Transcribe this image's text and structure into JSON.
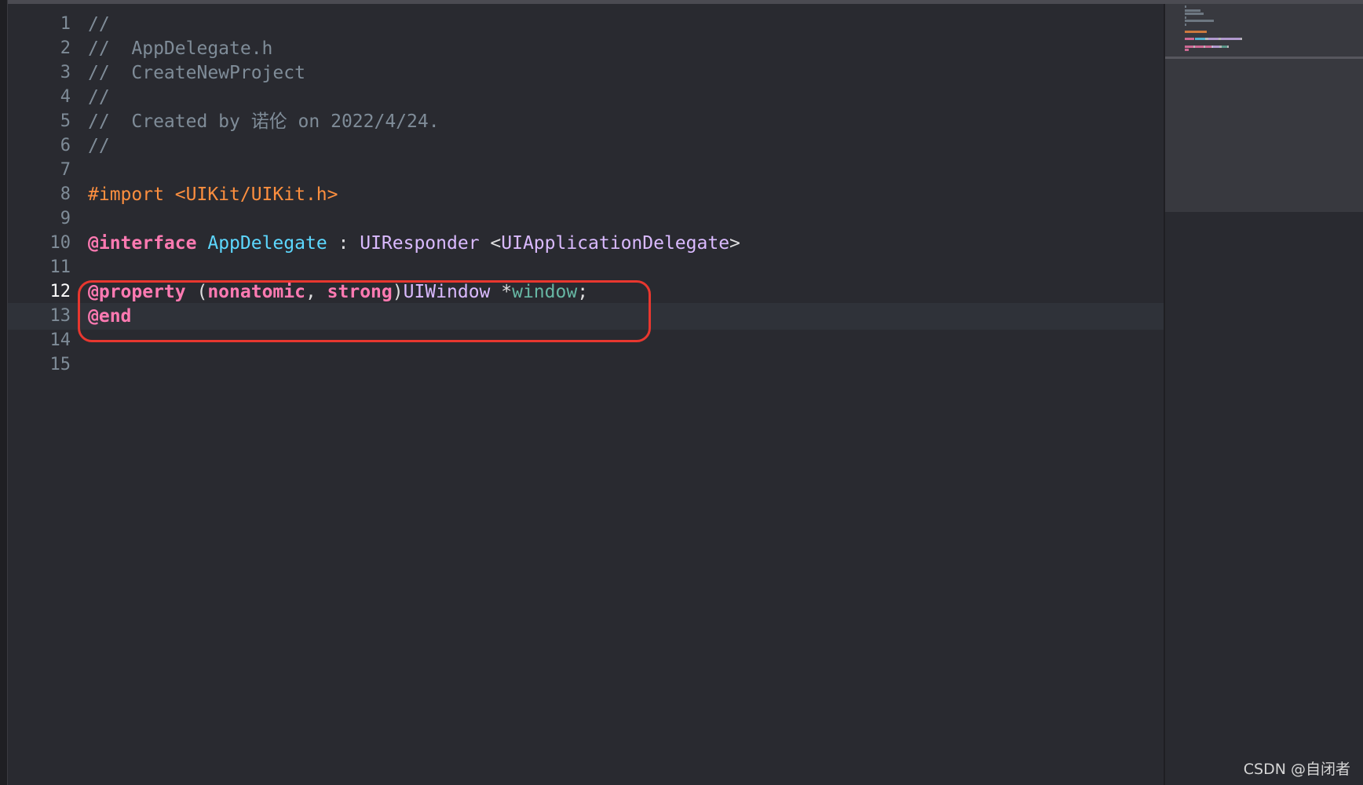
{
  "editor": {
    "current_line": "12",
    "line_numbers": [
      "1",
      "2",
      "3",
      "4",
      "5",
      "6",
      "7",
      "8",
      "9",
      "10",
      "11",
      "12",
      "13",
      "14",
      "15"
    ],
    "lines": [
      {
        "tokens": [
          {
            "kind": "comment",
            "text": "//"
          }
        ]
      },
      {
        "tokens": [
          {
            "kind": "comment",
            "text": "//  AppDelegate.h"
          }
        ]
      },
      {
        "tokens": [
          {
            "kind": "comment",
            "text": "//  CreateNewProject"
          }
        ]
      },
      {
        "tokens": [
          {
            "kind": "comment",
            "text": "//"
          }
        ]
      },
      {
        "tokens": [
          {
            "kind": "comment",
            "text": "//  Created by 诺伦 on 2022/4/24."
          }
        ]
      },
      {
        "tokens": [
          {
            "kind": "comment",
            "text": "//"
          }
        ]
      },
      {
        "tokens": []
      },
      {
        "tokens": [
          {
            "kind": "preproc",
            "text": "#import <UIKit/UIKit.h>"
          }
        ]
      },
      {
        "tokens": []
      },
      {
        "tokens": [
          {
            "kind": "keyword",
            "text": "@interface"
          },
          {
            "kind": "plain",
            "text": " "
          },
          {
            "kind": "class-decl",
            "text": "AppDelegate"
          },
          {
            "kind": "plain",
            "text": " : "
          },
          {
            "kind": "type-name",
            "text": "UIResponder"
          },
          {
            "kind": "plain",
            "text": " <"
          },
          {
            "kind": "type-name",
            "text": "UIApplicationDelegate"
          },
          {
            "kind": "plain",
            "text": ">"
          }
        ]
      },
      {
        "tokens": []
      },
      {
        "tokens": [
          {
            "kind": "keyword",
            "text": "@property"
          },
          {
            "kind": "plain",
            "text": " ("
          },
          {
            "kind": "keyword",
            "text": "nonatomic"
          },
          {
            "kind": "plain",
            "text": ", "
          },
          {
            "kind": "keyword",
            "text": "strong"
          },
          {
            "kind": "plain",
            "text": ")"
          },
          {
            "kind": "type-name",
            "text": "UIWindow"
          },
          {
            "kind": "plain",
            "text": " *"
          },
          {
            "kind": "ident",
            "text": "window"
          },
          {
            "kind": "plain",
            "text": ";"
          }
        ]
      },
      {
        "tokens": [
          {
            "kind": "keyword",
            "text": "@end"
          }
        ]
      },
      {
        "tokens": []
      },
      {
        "tokens": []
      }
    ]
  },
  "colors": {
    "background": "#292a30",
    "comment": "#7f8c98",
    "preprocessor": "#fd8f3f",
    "keyword": "#ff7ab2",
    "class_declaration": "#5dd8ff",
    "type_name": "#dabaff",
    "identifier": "#67b7a4",
    "plain_text": "#dfdfe0",
    "highlight_box": "#e8372f"
  },
  "watermark": {
    "text": "CSDN @自闭者"
  }
}
